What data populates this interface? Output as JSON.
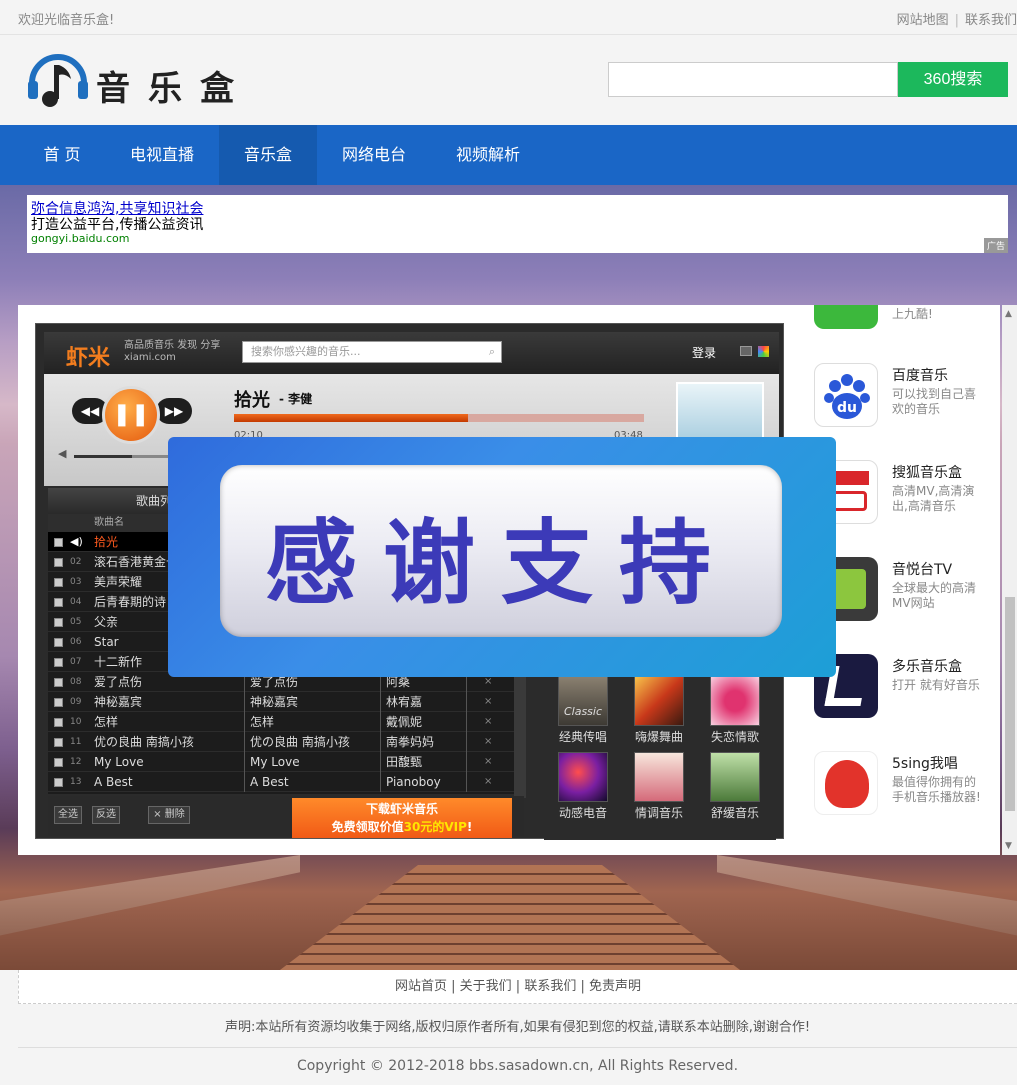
{
  "topbar": {
    "welcome": "欢迎光临音乐盒!",
    "links": [
      "网站地图",
      "联系我们"
    ]
  },
  "header": {
    "logo_text": "音乐盒",
    "search_placeholder": "",
    "search_button": "360搜索"
  },
  "nav": {
    "items": [
      {
        "label": "首 页",
        "active": false
      },
      {
        "label": "电视直播",
        "active": false
      },
      {
        "label": "音乐盒",
        "active": true
      },
      {
        "label": "网络电台",
        "active": false
      },
      {
        "label": "视频解析",
        "active": false
      }
    ]
  },
  "ad": {
    "line1": "弥合信息鸿沟,共享知识社会",
    "line2": "打造公益平台,传播公益资讯",
    "url": "gongyi.baidu.com",
    "tag": "广告"
  },
  "player": {
    "brand": "虾米",
    "brand_sub_line1": "高品质音乐 发现 分享",
    "brand_sub_line2": "xiami.com",
    "search_placeholder": "搜索你感兴趣的音乐...",
    "login": "登录",
    "controls": {
      "rewind": "◀◀",
      "pause": "❚❚",
      "forward": "▶▶"
    },
    "now_playing": {
      "title": "拾光",
      "artist": "- 李健",
      "time_current": "02:10",
      "time_total": "03:48",
      "progress": 0.57
    },
    "volume": 0.6,
    "list_header": "歌曲列表",
    "column_name": "歌曲名",
    "songs": [
      {
        "num": "",
        "name": "拾光",
        "album": "",
        "artist": "",
        "playing": true
      },
      {
        "num": "02",
        "name": "滚石香港黄金十",
        "album": "",
        "artist": ""
      },
      {
        "num": "03",
        "name": "美声荣耀",
        "album": "",
        "artist": ""
      },
      {
        "num": "04",
        "name": "后青春期的诗",
        "album": "",
        "artist": ""
      },
      {
        "num": "05",
        "name": "父亲",
        "album": "",
        "artist": ""
      },
      {
        "num": "06",
        "name": "Star",
        "album": "",
        "artist": ""
      },
      {
        "num": "07",
        "name": "十二新作",
        "album": "",
        "artist": ""
      },
      {
        "num": "08",
        "name": "爱了点伤",
        "album": "爱了点伤",
        "artist": "阿桑"
      },
      {
        "num": "09",
        "name": "神秘嘉宾",
        "album": "神秘嘉宾",
        "artist": "林宥嘉"
      },
      {
        "num": "10",
        "name": "怎样",
        "album": "怎样",
        "artist": "戴佩妮"
      },
      {
        "num": "11",
        "name": "优の良曲 南搞小孩",
        "album": "优の良曲 南搞小孩",
        "artist": "南拳妈妈"
      },
      {
        "num": "12",
        "name": "My Love",
        "album": "My Love",
        "artist": "田馥甄"
      },
      {
        "num": "13",
        "name": "A Best",
        "album": "A Best",
        "artist": "Pianoboy"
      }
    ],
    "bottom_buttons": [
      "全选",
      "反选",
      "× 删除"
    ],
    "download_banner": {
      "line1": "下载虾米音乐",
      "line2_pre": "免费领取价值",
      "line2_val": "30元的VIP",
      "line2_post": "!"
    },
    "genres": [
      "经典传唱",
      "嗨爆舞曲",
      "失恋情歌",
      "动感电音",
      "情调音乐",
      "舒缓音乐"
    ],
    "genre_thumb_text": "Classic"
  },
  "overlay": {
    "text": "感谢支持"
  },
  "sidebar": {
    "items": [
      {
        "name": "",
        "desc": "上九酷!",
        "color": "#3cb83c"
      },
      {
        "name": "百度音乐",
        "desc": "可以找到自己喜欢的音乐",
        "color": "#2a58d8"
      },
      {
        "name": "搜狐音乐盒",
        "desc": "高清MV,高清演出,高清音乐",
        "color": "#d9262b"
      },
      {
        "name": "音悦台TV",
        "desc": "全球最大的高清MV网站",
        "color": "#8cc63e"
      },
      {
        "name": "多乐音乐盒",
        "desc": "打开 就有好音乐",
        "color": "#1a1a40"
      },
      {
        "name": "5sing我唱",
        "desc": "最值得你拥有的手机音乐播放器!",
        "color": "#e2332b"
      }
    ]
  },
  "footer": {
    "links": "网站首页 | 关于我们 | 联系我们 | 免责声明",
    "notice": "声明:本站所有资源均收集于网络,版权归原作者所有,如果有侵犯到您的权益,请联系本站删除,谢谢合作!",
    "copyright": "Copyright © 2012-2018 bbs.sasadown.cn, All Rights Reserved."
  }
}
